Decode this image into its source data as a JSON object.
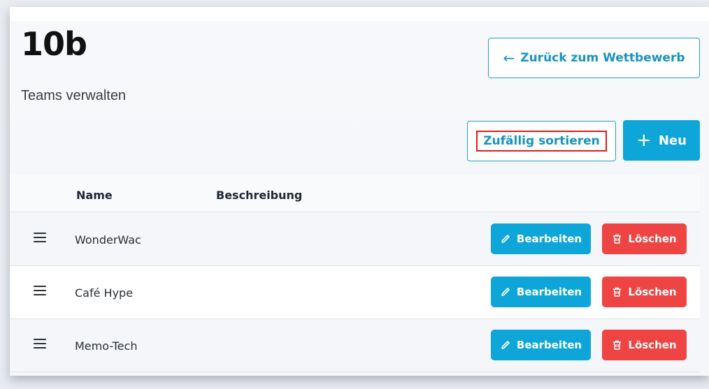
{
  "page": {
    "title": "10b",
    "subtitle": "Teams verwalten"
  },
  "toolbar": {
    "back_label": "Zurück zum Wettbewerb",
    "shuffle_label": "Zufällig sortieren",
    "new_label": "Neu"
  },
  "table": {
    "columns": [
      "Name",
      "Beschreibung"
    ],
    "rows": [
      {
        "name": "WonderWac",
        "description": ""
      },
      {
        "name": "Café Hype",
        "description": ""
      },
      {
        "name": "Memo-Tech",
        "description": ""
      }
    ],
    "edit_label": "Bearbeiten",
    "delete_label": "Löschen"
  },
  "icons": {
    "back": "arrow-left-icon",
    "new": "plus-icon",
    "drag": "drag-handle-icon",
    "edit": "pencil-icon",
    "delete": "trash-icon"
  },
  "colors": {
    "primary": "#0ea5d9",
    "danger": "#ef4444",
    "highlight": "#e01b1b"
  }
}
